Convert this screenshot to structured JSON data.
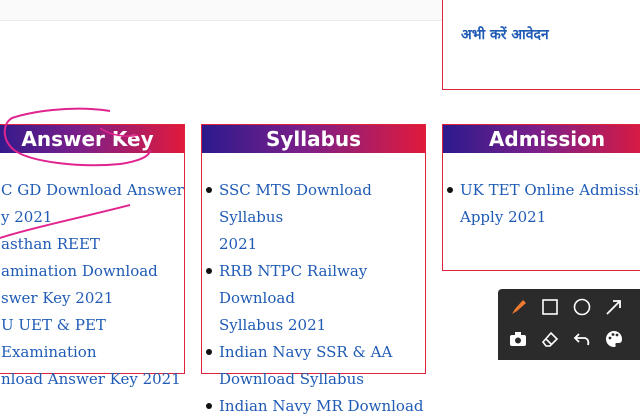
{
  "top_box": {
    "link": "अभी करें आवेदन"
  },
  "answer_key": {
    "title": "Answer Key",
    "lines": [
      "C GD Download Answer",
      "y 2021",
      "asthan REET",
      "amination Download",
      "swer Key 2021",
      "U UET & PET Examination",
      "nload Answer Key 2021"
    ]
  },
  "syllabus": {
    "title": "Syllabus",
    "lines": [
      "SSC MTS Download Syllabus",
      "2021",
      "RRB NTPC Railway Download",
      "Syllabus 2021",
      "Indian Navy SSR & AA",
      "Download Syllabus",
      "Indian Navy MR Download"
    ]
  },
  "admission": {
    "title": "Admission",
    "lines": [
      "UK TET Online Admission",
      "Apply 2021"
    ]
  },
  "colors": {
    "link": "#1f5bb5",
    "border": "#e0233a",
    "annotation": "#e0258f",
    "toolbar_bg": "#2b2b2b",
    "pen": "#f07a30"
  },
  "toolbar": {
    "row1": [
      "pen-icon",
      "rectangle-icon",
      "circle-icon",
      "arrow-icon"
    ],
    "row2": [
      "camera-icon",
      "eraser-icon",
      "undo-icon",
      "palette-icon"
    ]
  }
}
